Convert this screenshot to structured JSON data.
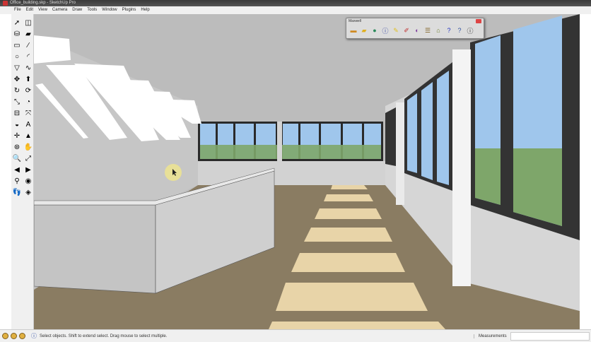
{
  "window": {
    "title": "Office_building.skp - SketchUp Pro"
  },
  "menu": [
    "File",
    "Edit",
    "View",
    "Camera",
    "Draw",
    "Tools",
    "Window",
    "Plugins",
    "Help"
  ],
  "tools": [
    {
      "icon": "select-icon",
      "g": "➚"
    },
    {
      "icon": "eraser-icon",
      "g": "◫"
    },
    {
      "icon": "paint-bucket-icon",
      "g": "⛁"
    },
    {
      "icon": "eraser2-icon",
      "g": "▰"
    },
    {
      "icon": "rectangle-icon",
      "g": "▭"
    },
    {
      "icon": "line-icon",
      "g": "∕"
    },
    {
      "icon": "circle-icon",
      "g": "○"
    },
    {
      "icon": "arc-icon",
      "g": "◜"
    },
    {
      "icon": "polygon-icon",
      "g": "▽"
    },
    {
      "icon": "freehand-icon",
      "g": "∿"
    },
    {
      "icon": "move-icon",
      "g": "✥"
    },
    {
      "icon": "push-pull-icon",
      "g": "⬆"
    },
    {
      "icon": "rotate-icon",
      "g": "↻"
    },
    {
      "icon": "follow-me-icon",
      "g": "⟳"
    },
    {
      "icon": "scale-icon",
      "g": "⤡"
    },
    {
      "icon": "offset-icon",
      "g": "◔"
    },
    {
      "icon": "tape-measure-icon",
      "g": "⊟"
    },
    {
      "icon": "dimension-icon",
      "g": "⤧"
    },
    {
      "icon": "protractor-icon",
      "g": "◒"
    },
    {
      "icon": "text-icon",
      "g": "A"
    },
    {
      "icon": "axes-icon",
      "g": "✛"
    },
    {
      "icon": "3d-text-icon",
      "g": "▲"
    },
    {
      "icon": "orbit-icon",
      "g": "⊛"
    },
    {
      "icon": "pan-icon",
      "g": "✋"
    },
    {
      "icon": "zoom-icon",
      "g": "🔍"
    },
    {
      "icon": "zoom-extents-icon",
      "g": "⤢"
    },
    {
      "icon": "previous-icon",
      "g": "◀"
    },
    {
      "icon": "next-icon",
      "g": "▶"
    },
    {
      "icon": "position-camera-icon",
      "g": "⚲"
    },
    {
      "icon": "look-around-icon",
      "g": "◉"
    },
    {
      "icon": "walk-icon",
      "g": "👣"
    },
    {
      "icon": "section-plane-icon",
      "g": "◈"
    }
  ],
  "maxwell": {
    "title": "Maxwell",
    "buttons": [
      {
        "icon": "render-icon",
        "g": "▬",
        "c": "#d08a20"
      },
      {
        "icon": "folder-icon",
        "g": "▰",
        "c": "#e0b020"
      },
      {
        "icon": "globe-icon",
        "g": "●",
        "c": "#2a8a5a"
      },
      {
        "icon": "info-settings-icon",
        "g": "ⓘ",
        "c": "#3040a0"
      },
      {
        "icon": "pencil-icon",
        "g": "✎",
        "c": "#e0c020"
      },
      {
        "icon": "pin-icon",
        "g": "✐",
        "c": "#c03030"
      },
      {
        "icon": "material-icon",
        "g": "◐",
        "c": "#8040a0"
      },
      {
        "icon": "layers-icon",
        "g": "☰",
        "c": "#806020"
      },
      {
        "icon": "scene-icon",
        "g": "⌂",
        "c": "#708030"
      },
      {
        "icon": "help-icon",
        "g": "?",
        "c": "#2030c0"
      },
      {
        "icon": "help2-icon",
        "g": "?",
        "c": "#3050a0"
      },
      {
        "icon": "about-icon",
        "g": "ⓘ",
        "c": "#222"
      }
    ]
  },
  "status": {
    "message": "Select objects. Shift to extend select. Drag mouse to select multiple.",
    "measurements_label": "Measurements",
    "measurements_value": ""
  }
}
